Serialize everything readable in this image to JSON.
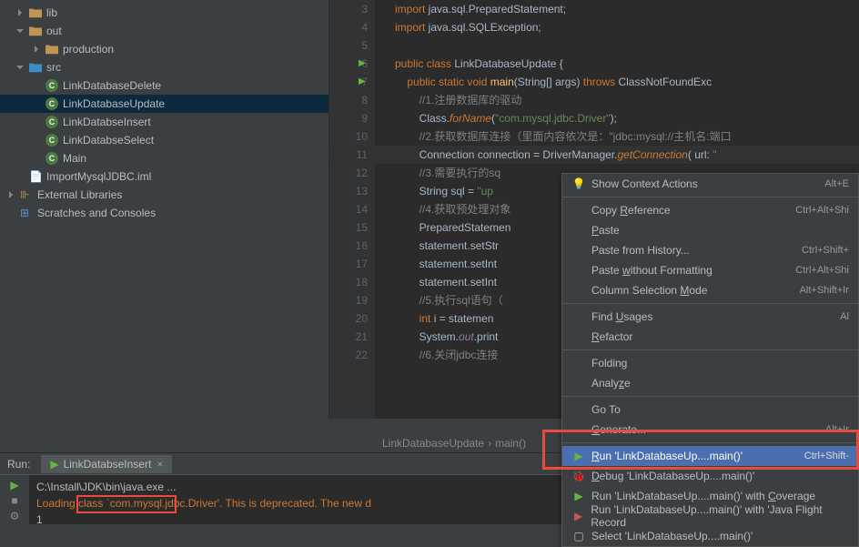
{
  "project": {
    "tree": [
      {
        "label": "lib",
        "type": "folder-orange",
        "indent": 1,
        "chevron": "right"
      },
      {
        "label": "out",
        "type": "folder-orange",
        "indent": 1,
        "chevron": "down"
      },
      {
        "label": "production",
        "type": "folder-orange",
        "indent": 2,
        "chevron": "right"
      },
      {
        "label": "src",
        "type": "folder-blue",
        "indent": 1,
        "chevron": "down"
      },
      {
        "label": "LinkDatabaseDelete",
        "type": "class",
        "indent": 2
      },
      {
        "label": "LinkDatabaseUpdate",
        "type": "class",
        "indent": 2,
        "selected": true
      },
      {
        "label": "LinkDatabseInsert",
        "type": "class",
        "indent": 2
      },
      {
        "label": "LinkDatabseSelect",
        "type": "class",
        "indent": 2
      },
      {
        "label": "Main",
        "type": "class",
        "indent": 2
      },
      {
        "label": "ImportMysqlJDBC.iml",
        "type": "file",
        "indent": 1
      },
      {
        "label": "External Libraries",
        "type": "lib",
        "indent": 0,
        "chevron": "right"
      },
      {
        "label": "Scratches and Consoles",
        "type": "scratch",
        "indent": 0
      }
    ]
  },
  "editor": {
    "lines": [
      {
        "num": 3,
        "type": "import",
        "pkg": "java.sql.PreparedStatement"
      },
      {
        "num": 4,
        "type": "import",
        "pkg": "java.sql.SQLException"
      },
      {
        "num": 5,
        "type": "blank"
      },
      {
        "num": 6,
        "type": "class-decl",
        "name": "LinkDatabaseUpdate",
        "run": true
      },
      {
        "num": 7,
        "type": "main-decl",
        "run": true
      },
      {
        "num": 8,
        "type": "comment",
        "text": "//1.注册数据库的驱动"
      },
      {
        "num": 9,
        "type": "forname",
        "arg": "\"com.mysql.jdbc.Driver\""
      },
      {
        "num": 10,
        "type": "comment",
        "text": "//2.获取数据库连接（里面内容依次是：\"jdbc:mysql://主机名:端口"
      },
      {
        "num": 11,
        "type": "connection",
        "hl": true
      },
      {
        "num": 12,
        "type": "comment",
        "text": "//3.需要执行的sq"
      },
      {
        "num": 13,
        "type": "sql-string"
      },
      {
        "num": 14,
        "type": "comment",
        "text": "//4.获取预处理对象"
      },
      {
        "num": 15,
        "type": "prepstmt"
      },
      {
        "num": 16,
        "type": "setstr"
      },
      {
        "num": 17,
        "type": "setint1"
      },
      {
        "num": 18,
        "type": "setint2"
      },
      {
        "num": 19,
        "type": "comment",
        "text": "//5.执行sql语句（"
      },
      {
        "num": 20,
        "type": "execupdate"
      },
      {
        "num": 21,
        "type": "println"
      },
      {
        "num": 22,
        "type": "comment",
        "text": "//6.关闭jdbc连接"
      }
    ]
  },
  "breadcrumb": {
    "file": "LinkDatabaseUpdate",
    "method": "main()"
  },
  "run": {
    "title": "Run:",
    "tab": "LinkDatabseInsert",
    "output": {
      "line1": "C:\\Install\\JDK\\bin\\java.exe ...",
      "line2_pre": "Loading class",
      "line2_mid": "`com.mysql.jdbc.Driver'. This is deprecated. The new d",
      "line3": "1"
    }
  },
  "menu": {
    "items": [
      {
        "icon": "bulb",
        "label": "Show Context Actions",
        "shortcut": "Alt+E"
      },
      {
        "sep": true
      },
      {
        "label": "Copy Reference",
        "shortcut": "Ctrl+Alt+Shi",
        "u": "R"
      },
      {
        "label": "Paste",
        "shortcut": "",
        "u": "P"
      },
      {
        "label": "Paste from History...",
        "shortcut": "Ctrl+Shift+",
        "u": null
      },
      {
        "label": "Paste without Formatting",
        "shortcut": "Ctrl+Alt+Shi",
        "u": "w"
      },
      {
        "label": "Column Selection Mode",
        "shortcut": "Alt+Shift+Ir",
        "u": "M"
      },
      {
        "sep": true
      },
      {
        "label": "Find Usages",
        "shortcut": "Al",
        "u": "U"
      },
      {
        "label": "Refactor",
        "shortcut": "",
        "u": "R"
      },
      {
        "sep": true
      },
      {
        "label": "Folding",
        "shortcut": ""
      },
      {
        "label": "Analyze",
        "shortcut": "",
        "u": "z"
      },
      {
        "sep": true
      },
      {
        "label": "Go To",
        "shortcut": ""
      },
      {
        "label": "Generate...",
        "shortcut": "Alt+Ir",
        "u": "G"
      },
      {
        "sep": true
      },
      {
        "icon": "run",
        "label": "Run 'LinkDatabaseUp....main()'",
        "shortcut": "Ctrl+Shift-",
        "highlighted": true,
        "u": "R"
      },
      {
        "icon": "debug",
        "label": "Debug 'LinkDatabaseUp....main()'",
        "shortcut": "",
        "u": "D"
      },
      {
        "icon": "run",
        "label": "Run 'LinkDatabaseUp....main()' with Coverage",
        "shortcut": "",
        "u": "C"
      },
      {
        "icon": "run-red",
        "label": "Run 'LinkDatabaseUp....main()' with 'Java Flight Record",
        "shortcut": ""
      },
      {
        "icon": "select",
        "label": "Select 'LinkDatabaseUp....main()'",
        "shortcut": ""
      }
    ]
  }
}
